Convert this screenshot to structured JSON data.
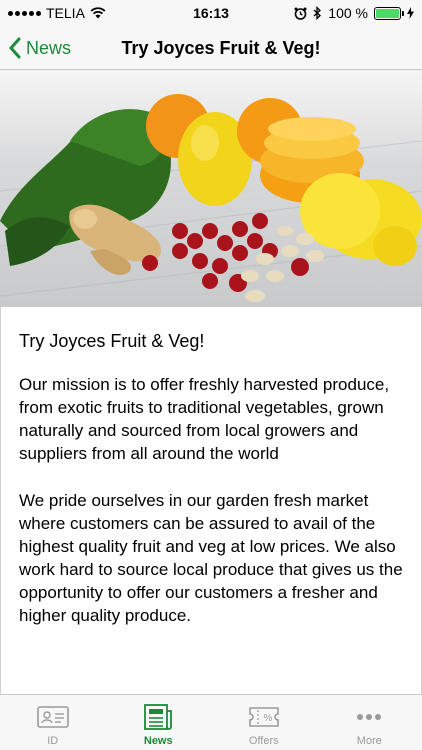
{
  "status_bar": {
    "carrier": "TELIA",
    "time": "16:13",
    "battery_percent": "100 %"
  },
  "nav": {
    "back_label": "News",
    "title": "Try Joyces Fruit & Veg!"
  },
  "article": {
    "title": "Try Joyces Fruit & Veg!",
    "paragraphs": [
      "Our mission is to offer freshly harvested produce, from exotic fruits to traditional vegetables, grown naturally and sourced from local growers and suppliers from all around the world",
      "We pride ourselves in our garden fresh market where customers can be assured to avail of the highest quality fruit and veg at low prices. We also work hard to source local produce that gives us the opportunity to offer our customers a fresher and higher quality produce."
    ]
  },
  "tabs": [
    {
      "label": "ID",
      "icon": "id-card-icon",
      "active": false
    },
    {
      "label": "News",
      "icon": "newspaper-icon",
      "active": true
    },
    {
      "label": "Offers",
      "icon": "offers-ticket-icon",
      "active": false
    },
    {
      "label": "More",
      "icon": "more-dots-icon",
      "active": false
    }
  ],
  "colors": {
    "accent": "#1a8a3a",
    "tab_inactive": "#9a9a9a",
    "battery": "#4cd964"
  }
}
